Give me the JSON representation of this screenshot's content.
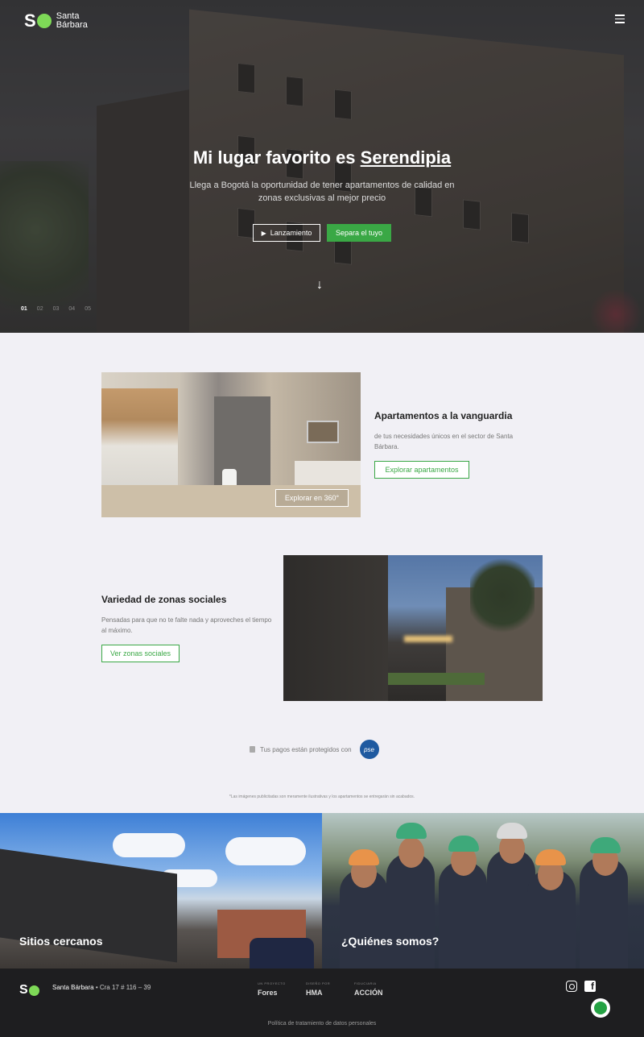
{
  "header": {
    "logo_letter": "S",
    "logo_line1": "Santa",
    "logo_line2": "Bárbara",
    "menu_icon": "hamburger-menu-icon"
  },
  "hero": {
    "title_prefix": "Mi lugar favorito es",
    "title_highlight": "Serendipia",
    "subtitle": "Llega a Bogotá la oportunidad de tener apartamentos de calidad en zonas exclusivas al mejor precio",
    "button_launch": "Lanzamiento",
    "button_reserve": "Separa el tuyo",
    "slides": [
      "01",
      "02",
      "03",
      "04",
      "05"
    ],
    "active_slide": "01"
  },
  "features": [
    {
      "title": "Apartamentos a la vanguardia",
      "description": "de tus necesidades únicos en el sector de Santa Bárbara.",
      "button": "Explorar apartamentos",
      "image_button": "Explorar en 360°"
    },
    {
      "title": "Variedad de zonas sociales",
      "description": "Pensadas para que no te falte nada y aproveches el tiempo al máximo.",
      "button": "Ver zonas sociales"
    }
  ],
  "payments": {
    "text": "Tus pagos están protegidos con",
    "badge": "pse"
  },
  "disclaimer": "*Las imágenes publicitadas son meramente ilustrativas y los apartamentos se entregarán sin acabados.",
  "panels": {
    "left": "Sitios cercanos",
    "right": "¿Quiénes somos?"
  },
  "footer": {
    "brand": "Santa Bárbara",
    "address": "Cra 17 # 116 – 39",
    "partners": [
      {
        "label": "UN PROYECTO",
        "name": "Fores"
      },
      {
        "label": "DISEÑO POR",
        "name": "HMA"
      },
      {
        "label": "FIDUCIARIA",
        "name": "ACCIÓN"
      }
    ],
    "policy": "Política de tratamiento de datos personales"
  },
  "colors": {
    "accent_green": "#3aa845",
    "logo_green": "#7ed957",
    "background": "#f1f0f5",
    "footer": "#1e1e20"
  }
}
